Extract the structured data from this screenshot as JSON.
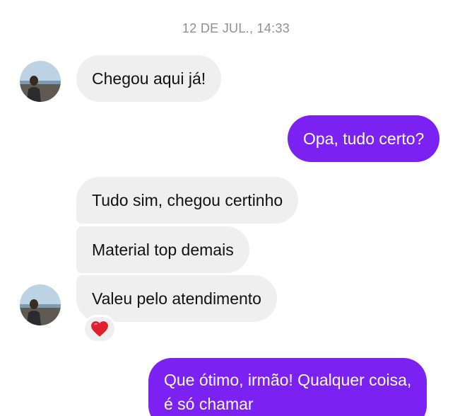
{
  "conversation": {
    "timestamp": "12 DE JUL., 14:33",
    "messages": [
      {
        "from": "contact",
        "text": "Chegou aqui já!"
      },
      {
        "from": "me",
        "text": "Opa, tudo certo?"
      },
      {
        "from": "contact",
        "text": "Tudo sim, chegou certinho"
      },
      {
        "from": "contact",
        "text": "Material top demais"
      },
      {
        "from": "contact",
        "text": "Valeu pelo atendimento",
        "reaction": "heart-icon"
      },
      {
        "from": "me",
        "text_line1": "Que ótimo, irmão! Qualquer coisa,",
        "text_line2": "é só chamar"
      }
    ]
  },
  "colors": {
    "outgoing_bubble": "#7b22f2",
    "incoming_bubble": "#efefef",
    "timestamp": "#8e8e93",
    "reaction": "#e0202e"
  }
}
